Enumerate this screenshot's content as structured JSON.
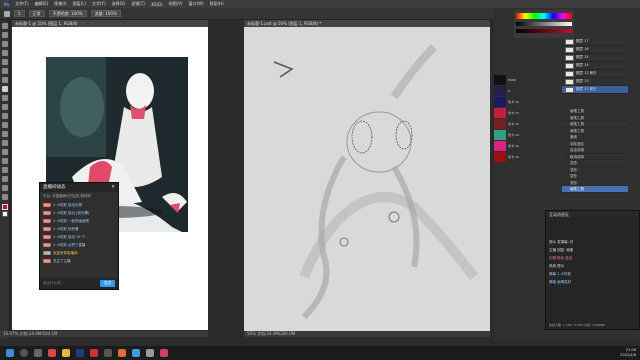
{
  "menu": [
    "Ps",
    "文件(F)",
    "编辑(E)",
    "图像(I)",
    "图层(L)",
    "文字(Y)",
    "选择(S)",
    "滤镜(T)",
    "3D(D)",
    "视图(V)",
    "窗口(W)",
    "帮助(H)"
  ],
  "options": {
    "size": "5",
    "mode": "正常",
    "opacity": "不透明度: 100%",
    "flow": "流量: 100%"
  },
  "doc_left": {
    "tab": "未标题-1 @ 50% (图层 1, RGB/8)",
    "status": "16.67%   文档:24.4M/104.1M"
  },
  "doc_right": {
    "tab": "未标题-1.psd @ 50% (图层 1, RGB/8) *",
    "status": "50%   文档:24.4M/200.0M"
  },
  "chat": {
    "title": "直播间动态",
    "notice": "平台: 本直播间已开启礼物特效",
    "messages": [
      {
        "tag": "粉丝",
        "text": "1 小时前 送出礼物"
      },
      {
        "tag": "粉丝",
        "text": "1 小时前 送出 [荧光棒]"
      },
      {
        "tag": "粉丝",
        "text": "1 小时前 一起来画画吧"
      },
      {
        "tag": "粉丝",
        "text": "1 小时前 好好看"
      },
      {
        "tag": "粉丝",
        "text": "1 小时前 送出 10 个"
      },
      {
        "tag": "粉丝",
        "text": "1 小时前 点赞了直播"
      },
      {
        "tag": "系统",
        "text": "欢迎来到直播间"
      },
      {
        "tag": "粉丝",
        "text": "关注了主播"
      }
    ],
    "input_placeholder": "说点什么吧...",
    "send_label": "发送"
  },
  "swatches": [
    "#111111",
    "#222244",
    "#1a1a60",
    "#c02040",
    "#7a2020",
    "#30a080",
    "#e02080",
    "#9a1010"
  ],
  "swatch_labels": [
    "6666",
    "6",
    "色卡 16",
    "色卡 16",
    "色卡 16",
    "色卡 16",
    "色卡 16",
    "色卡 16"
  ],
  "layers": [
    {
      "name": "图层 17"
    },
    {
      "name": "图层 16"
    },
    {
      "name": "图层 15"
    },
    {
      "name": "图层 14"
    },
    {
      "name": "图层 13 拷贝"
    },
    {
      "name": "图层 13"
    },
    {
      "name": "图层 12 拷贝"
    }
  ],
  "history": [
    "画笔工具",
    "画笔工具",
    "画笔工具",
    "画笔工具",
    "套索",
    "羽化选区",
    "自由变换",
    "取消选择",
    "变形",
    "变形",
    "变形",
    "变形",
    "画笔工具"
  ],
  "dm": {
    "title": "互动消息区",
    "rows": [
      "观众 发弹幕: 好",
      "主播 回复: 谢谢",
      "礼物 粉丝 送出",
      "系统 提示",
      "弹幕 1 小时前",
      "弹幕 画得真好"
    ],
    "stats": "在线人数: 1   CPU: 3.33%   内存: 2198MB"
  },
  "clock": {
    "time": "21:08",
    "date": "2022/4/6"
  }
}
